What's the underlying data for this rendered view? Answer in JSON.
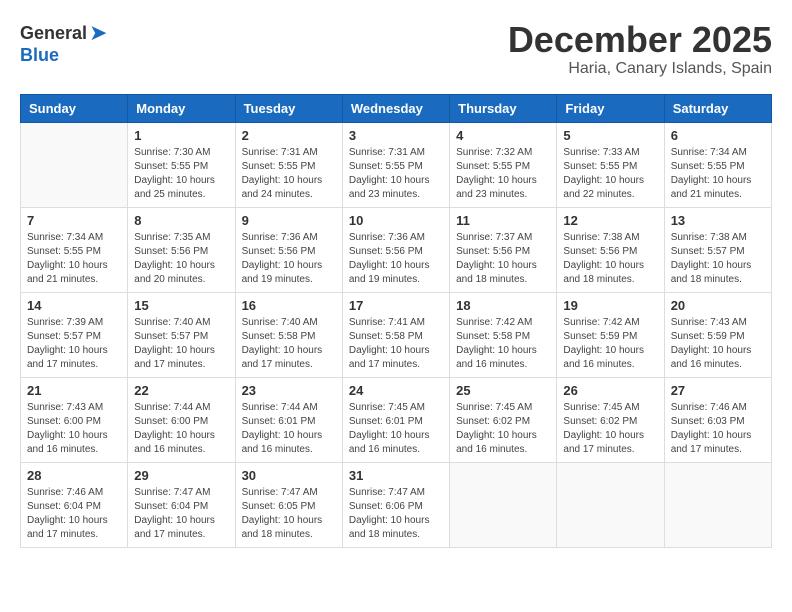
{
  "logo": {
    "general": "General",
    "blue": "Blue"
  },
  "title": "December 2025",
  "location": "Haria, Canary Islands, Spain",
  "weekdays": [
    "Sunday",
    "Monday",
    "Tuesday",
    "Wednesday",
    "Thursday",
    "Friday",
    "Saturday"
  ],
  "weeks": [
    [
      {
        "day": "",
        "info": ""
      },
      {
        "day": "1",
        "info": "Sunrise: 7:30 AM\nSunset: 5:55 PM\nDaylight: 10 hours\nand 25 minutes."
      },
      {
        "day": "2",
        "info": "Sunrise: 7:31 AM\nSunset: 5:55 PM\nDaylight: 10 hours\nand 24 minutes."
      },
      {
        "day": "3",
        "info": "Sunrise: 7:31 AM\nSunset: 5:55 PM\nDaylight: 10 hours\nand 23 minutes."
      },
      {
        "day": "4",
        "info": "Sunrise: 7:32 AM\nSunset: 5:55 PM\nDaylight: 10 hours\nand 23 minutes."
      },
      {
        "day": "5",
        "info": "Sunrise: 7:33 AM\nSunset: 5:55 PM\nDaylight: 10 hours\nand 22 minutes."
      },
      {
        "day": "6",
        "info": "Sunrise: 7:34 AM\nSunset: 5:55 PM\nDaylight: 10 hours\nand 21 minutes."
      }
    ],
    [
      {
        "day": "7",
        "info": "Sunrise: 7:34 AM\nSunset: 5:55 PM\nDaylight: 10 hours\nand 21 minutes."
      },
      {
        "day": "8",
        "info": "Sunrise: 7:35 AM\nSunset: 5:56 PM\nDaylight: 10 hours\nand 20 minutes."
      },
      {
        "day": "9",
        "info": "Sunrise: 7:36 AM\nSunset: 5:56 PM\nDaylight: 10 hours\nand 19 minutes."
      },
      {
        "day": "10",
        "info": "Sunrise: 7:36 AM\nSunset: 5:56 PM\nDaylight: 10 hours\nand 19 minutes."
      },
      {
        "day": "11",
        "info": "Sunrise: 7:37 AM\nSunset: 5:56 PM\nDaylight: 10 hours\nand 18 minutes."
      },
      {
        "day": "12",
        "info": "Sunrise: 7:38 AM\nSunset: 5:56 PM\nDaylight: 10 hours\nand 18 minutes."
      },
      {
        "day": "13",
        "info": "Sunrise: 7:38 AM\nSunset: 5:57 PM\nDaylight: 10 hours\nand 18 minutes."
      }
    ],
    [
      {
        "day": "14",
        "info": "Sunrise: 7:39 AM\nSunset: 5:57 PM\nDaylight: 10 hours\nand 17 minutes."
      },
      {
        "day": "15",
        "info": "Sunrise: 7:40 AM\nSunset: 5:57 PM\nDaylight: 10 hours\nand 17 minutes."
      },
      {
        "day": "16",
        "info": "Sunrise: 7:40 AM\nSunset: 5:58 PM\nDaylight: 10 hours\nand 17 minutes."
      },
      {
        "day": "17",
        "info": "Sunrise: 7:41 AM\nSunset: 5:58 PM\nDaylight: 10 hours\nand 17 minutes."
      },
      {
        "day": "18",
        "info": "Sunrise: 7:42 AM\nSunset: 5:58 PM\nDaylight: 10 hours\nand 16 minutes."
      },
      {
        "day": "19",
        "info": "Sunrise: 7:42 AM\nSunset: 5:59 PM\nDaylight: 10 hours\nand 16 minutes."
      },
      {
        "day": "20",
        "info": "Sunrise: 7:43 AM\nSunset: 5:59 PM\nDaylight: 10 hours\nand 16 minutes."
      }
    ],
    [
      {
        "day": "21",
        "info": "Sunrise: 7:43 AM\nSunset: 6:00 PM\nDaylight: 10 hours\nand 16 minutes."
      },
      {
        "day": "22",
        "info": "Sunrise: 7:44 AM\nSunset: 6:00 PM\nDaylight: 10 hours\nand 16 minutes."
      },
      {
        "day": "23",
        "info": "Sunrise: 7:44 AM\nSunset: 6:01 PM\nDaylight: 10 hours\nand 16 minutes."
      },
      {
        "day": "24",
        "info": "Sunrise: 7:45 AM\nSunset: 6:01 PM\nDaylight: 10 hours\nand 16 minutes."
      },
      {
        "day": "25",
        "info": "Sunrise: 7:45 AM\nSunset: 6:02 PM\nDaylight: 10 hours\nand 16 minutes."
      },
      {
        "day": "26",
        "info": "Sunrise: 7:45 AM\nSunset: 6:02 PM\nDaylight: 10 hours\nand 17 minutes."
      },
      {
        "day": "27",
        "info": "Sunrise: 7:46 AM\nSunset: 6:03 PM\nDaylight: 10 hours\nand 17 minutes."
      }
    ],
    [
      {
        "day": "28",
        "info": "Sunrise: 7:46 AM\nSunset: 6:04 PM\nDaylight: 10 hours\nand 17 minutes."
      },
      {
        "day": "29",
        "info": "Sunrise: 7:47 AM\nSunset: 6:04 PM\nDaylight: 10 hours\nand 17 minutes."
      },
      {
        "day": "30",
        "info": "Sunrise: 7:47 AM\nSunset: 6:05 PM\nDaylight: 10 hours\nand 18 minutes."
      },
      {
        "day": "31",
        "info": "Sunrise: 7:47 AM\nSunset: 6:06 PM\nDaylight: 10 hours\nand 18 minutes."
      },
      {
        "day": "",
        "info": ""
      },
      {
        "day": "",
        "info": ""
      },
      {
        "day": "",
        "info": ""
      }
    ]
  ]
}
